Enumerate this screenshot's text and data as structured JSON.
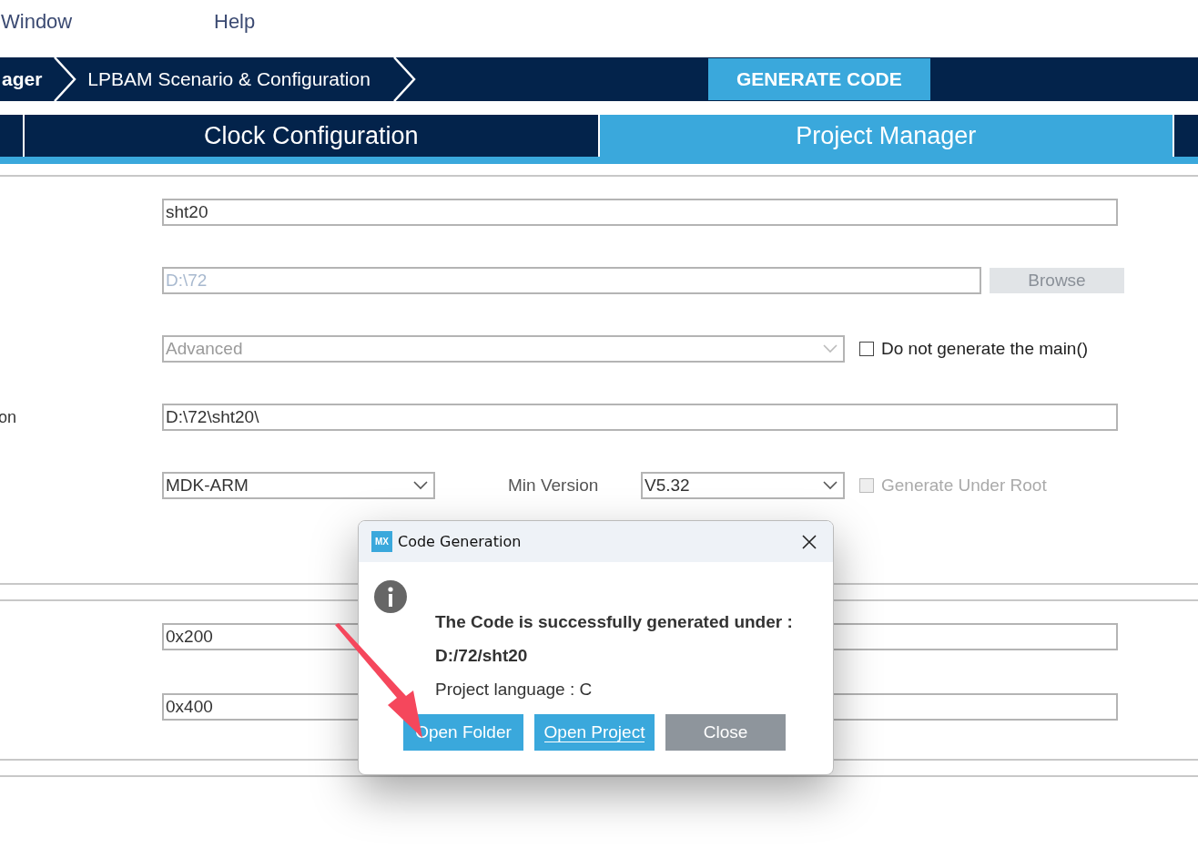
{
  "menu": [
    "Window",
    "Help"
  ],
  "breadcrumbs": [
    "ager",
    "LPBAM Scenario & Configuration"
  ],
  "generate_button": "GENERATE CODE",
  "tabs": [
    {
      "label": "Clock Configuration",
      "selected": false
    },
    {
      "label": "Project Manager",
      "selected": true
    }
  ],
  "settings": [
    {
      "kind": "text",
      "value": "sht20",
      "disabled": false
    },
    {
      "kind": "browse",
      "value": "D:\\72",
      "disabled": true,
      "button": "Browse"
    },
    {
      "kind": "select-check",
      "value": "Advanced",
      "disabled": true,
      "checkbox": {
        "label": "Do not generate the main()",
        "checked": false,
        "disabled": false
      }
    },
    {
      "kind": "text",
      "label": "on",
      "value": "D:\\72\\sht20\\",
      "disabled": false
    },
    {
      "kind": "toolchain",
      "value": "MDK-ARM",
      "disabled": false,
      "min_label": "Min Version",
      "min_value": "V5.32",
      "checkbox": {
        "label": "Generate Under Root",
        "checked": false,
        "disabled": true
      }
    }
  ],
  "heap_fields": [
    "0x200",
    "0x400"
  ],
  "dialog": {
    "logo": "MX",
    "title": "Code Generation",
    "message": "The Code is successfully generated under :",
    "path": "D:/72/sht20",
    "language": "Project language : C",
    "buttons": [
      {
        "label": "Open Folder",
        "kind": "primary",
        "focused": false
      },
      {
        "label": "Open Project",
        "kind": "primary",
        "focused": true
      },
      {
        "label": "Close",
        "kind": "secondary",
        "focused": false
      }
    ]
  }
}
